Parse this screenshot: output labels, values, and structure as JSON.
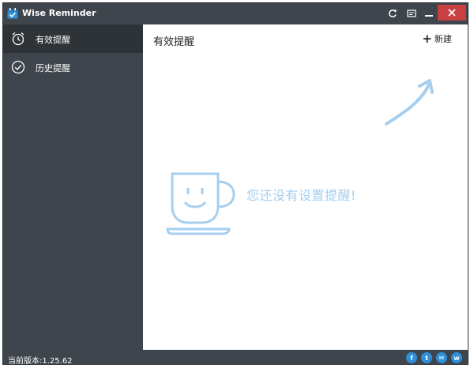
{
  "window": {
    "title": "Wise Reminder",
    "icons": {
      "app": "calendar-check-icon",
      "refresh": "refresh-icon",
      "settings": "settings-icon",
      "minimize": "minimize-icon",
      "close": "close-icon"
    }
  },
  "sidebar": {
    "items": [
      {
        "label": "有效提醒",
        "icon": "alarm-clock-icon",
        "active": true
      },
      {
        "label": "历史提醒",
        "icon": "check-circle-icon",
        "active": false
      }
    ]
  },
  "main": {
    "title": "有效提醒",
    "new_label": "新建",
    "new_icon": "plus-icon",
    "empty_message": "您还没有设置提醒!",
    "empty_icon": "coffee-cup-smile-icon",
    "hint_icon": "curved-arrow-icon"
  },
  "footer": {
    "version": "当前版本:1.25.62",
    "social": [
      {
        "label": "f",
        "icon": "facebook-icon"
      },
      {
        "label": "t",
        "icon": "twitter-icon"
      },
      {
        "label": "✉",
        "icon": "mail-icon"
      },
      {
        "label": "w",
        "icon": "weibo-icon"
      }
    ]
  },
  "colors": {
    "frame": "#3f454c",
    "active_item": "#2e3338",
    "close": "#c94040",
    "accent": "#a6cfef",
    "social": "#2f8fd8"
  }
}
